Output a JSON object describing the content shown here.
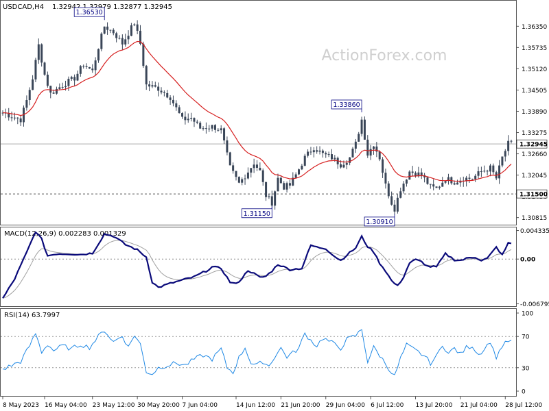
{
  "header": {
    "symbol": "USDCAD,H4",
    "ohlc": "1.32942 1.32979 1.32877 1.32945"
  },
  "watermark": "ActionForex.com",
  "colors": {
    "candle": "#3a4658",
    "ma": "#d62020",
    "macd_line": "#0a0a7a",
    "macd_signal": "#a0a0a0",
    "rsi": "#1e88e5",
    "frame": "#555555",
    "guide_line": "#7a7a7a"
  },
  "chart_data": [
    {
      "type": "line",
      "panel": "price",
      "title": "",
      "ylim": [
        1.3065,
        1.3705
      ],
      "y_ticks": [
        1.3635,
        1.35735,
        1.3512,
        1.34505,
        1.3389,
        1.33275,
        1.3266,
        1.32045,
        1.3143,
        1.30815
      ],
      "y_tick_labels": [
        "1.36350",
        "1.35735",
        "1.35120",
        "1.34505",
        "1.33890",
        "1.33275",
        "1.32660",
        "1.32045",
        "1.31430",
        "1.30815"
      ],
      "x_ticks": [
        0,
        14,
        30,
        45,
        60,
        78,
        93,
        108,
        123,
        138,
        153,
        168
      ],
      "x_tick_labels": [
        "8 May 2023",
        "16 May 04:00",
        "23 May 12:00",
        "30 May 20:00",
        "7 Jun 04:00",
        "14 Jun 12:00",
        "21 Jun 20:00",
        "29 Jun 04:00",
        "6 Jul 12:00",
        "13 Jul 20:00",
        "21 Jul 04:00",
        "28 Jul 12:00"
      ],
      "xlim": [
        0,
        170
      ],
      "close_anchors": [
        [
          0,
          1.3385
        ],
        [
          3,
          1.3375
        ],
        [
          6,
          1.3365
        ],
        [
          8,
          1.342
        ],
        [
          10,
          1.3485
        ],
        [
          12,
          1.358
        ],
        [
          14,
          1.3495
        ],
        [
          16,
          1.344
        ],
        [
          20,
          1.3465
        ],
        [
          24,
          1.3485
        ],
        [
          27,
          1.3525
        ],
        [
          30,
          1.3505
        ],
        [
          32,
          1.3575
        ],
        [
          34,
          1.3635
        ],
        [
          37,
          1.3618
        ],
        [
          40,
          1.3585
        ],
        [
          42,
          1.3615
        ],
        [
          44,
          1.3645
        ],
        [
          46,
          1.3585
        ],
        [
          48,
          1.3465
        ],
        [
          52,
          1.3455
        ],
        [
          56,
          1.343
        ],
        [
          60,
          1.3365
        ],
        [
          63,
          1.337
        ],
        [
          66,
          1.334
        ],
        [
          70,
          1.3345
        ],
        [
          73,
          1.3335
        ],
        [
          76,
          1.3225
        ],
        [
          79,
          1.318
        ],
        [
          82,
          1.3215
        ],
        [
          84,
          1.324
        ],
        [
          86,
          1.3215
        ],
        [
          88,
          1.3145
        ],
        [
          90,
          1.3125
        ],
        [
          92,
          1.3195
        ],
        [
          94,
          1.317
        ],
        [
          96,
          1.3175
        ],
        [
          98,
          1.3205
        ],
        [
          101,
          1.3255
        ],
        [
          104,
          1.3285
        ],
        [
          107,
          1.3265
        ],
        [
          110,
          1.3255
        ],
        [
          113,
          1.3235
        ],
        [
          116,
          1.3255
        ],
        [
          118,
          1.3295
        ],
        [
          120,
          1.3365
        ],
        [
          122,
          1.3265
        ],
        [
          124,
          1.3295
        ],
        [
          126,
          1.3255
        ],
        [
          128,
          1.3175
        ],
        [
          130,
          1.3125
        ],
        [
          131,
          1.3108
        ],
        [
          133,
          1.3165
        ],
        [
          136,
          1.3215
        ],
        [
          140,
          1.3205
        ],
        [
          143,
          1.317
        ],
        [
          145,
          1.3165
        ],
        [
          148,
          1.3195
        ],
        [
          151,
          1.3185
        ],
        [
          154,
          1.3195
        ],
        [
          157,
          1.3195
        ],
        [
          160,
          1.3215
        ],
        [
          163,
          1.3225
        ],
        [
          165,
          1.3195
        ],
        [
          167,
          1.3255
        ],
        [
          169,
          1.3295
        ]
      ],
      "series": [
        {
          "name": "",
          "style": "candles",
          "values": "derived from close_anchors"
        },
        {
          "name": "",
          "style": "moving-average",
          "values": "smoothed closes"
        }
      ],
      "annotations": [
        {
          "text": "1.36530",
          "x": 34,
          "y": 1.3653
        },
        {
          "text": "1.33860",
          "x": 120,
          "y": 1.3386
        },
        {
          "text": "1.31150",
          "x": 90,
          "y": 1.3115
        },
        {
          "text": "1.30910",
          "x": 131,
          "y": 1.3091
        }
      ],
      "price_line": {
        "value": 1.32945,
        "label": "1.32945"
      },
      "level_line": {
        "value": 1.315,
        "label": "1.31500",
        "style": "dashed"
      }
    },
    {
      "type": "line",
      "panel": "macd",
      "title": "MACD(12,26,9) 0.002283 0.001329",
      "ylim": [
        -0.00705,
        0.0046
      ],
      "y_ticks": [
        0.004335,
        0.0,
        -0.006795
      ],
      "y_tick_labels": [
        "0.004335",
        "0.00",
        "-0.006795"
      ],
      "macd_anchors": [
        [
          0,
          -0.006
        ],
        [
          4,
          -0.003
        ],
        [
          8,
          0.001
        ],
        [
          11,
          0.0042
        ],
        [
          13,
          0.003
        ],
        [
          15,
          0.0005
        ],
        [
          18,
          0.0008
        ],
        [
          22,
          0.0008
        ],
        [
          26,
          0.0007
        ],
        [
          30,
          0.0009
        ],
        [
          34,
          0.0038
        ],
        [
          37,
          0.0035
        ],
        [
          41,
          0.0022
        ],
        [
          45,
          0.0014
        ],
        [
          48,
          0.0003
        ],
        [
          50,
          -0.0035
        ],
        [
          52,
          -0.0043
        ],
        [
          56,
          -0.0037
        ],
        [
          60,
          -0.0032
        ],
        [
          64,
          -0.0027
        ],
        [
          68,
          -0.0018
        ],
        [
          70,
          -0.0012
        ],
        [
          73,
          -0.0014
        ],
        [
          76,
          -0.0035
        ],
        [
          78,
          -0.0038
        ],
        [
          80,
          -0.0029
        ],
        [
          82,
          -0.0017
        ],
        [
          84,
          -0.0022
        ],
        [
          86,
          -0.0028
        ],
        [
          88,
          -0.0026
        ],
        [
          90,
          -0.0018
        ],
        [
          92,
          -0.0008
        ],
        [
          94,
          -0.0012
        ],
        [
          96,
          -0.0016
        ],
        [
          100,
          -0.0014
        ],
        [
          103,
          0.0021
        ],
        [
          105,
          0.0018
        ],
        [
          108,
          0.0016
        ],
        [
          111,
          0.0004
        ],
        [
          113,
          -0.0002
        ],
        [
          115,
          0.0006
        ],
        [
          118,
          0.0017
        ],
        [
          120,
          0.0034
        ],
        [
          122,
          0.0019
        ],
        [
          124,
          0.0011
        ],
        [
          126,
          -0.0006
        ],
        [
          128,
          -0.0018
        ],
        [
          130,
          -0.0033
        ],
        [
          132,
          -0.0041
        ],
        [
          134,
          -0.0027
        ],
        [
          136,
          -0.0006
        ],
        [
          138,
          -0.0001
        ],
        [
          140,
          -0.0004
        ],
        [
          142,
          -0.0011
        ],
        [
          145,
          -0.0012
        ],
        [
          148,
          0.0008
        ],
        [
          151,
          -0.0001
        ],
        [
          153,
          -0.0002
        ],
        [
          156,
          0.0002
        ],
        [
          158,
          0.0003
        ],
        [
          160,
          -0.0002
        ],
        [
          162,
          0.0001
        ],
        [
          165,
          0.0018
        ],
        [
          167,
          0.0006
        ],
        [
          169,
          0.0024
        ]
      ],
      "series": [
        {
          "name": "",
          "style": "macd",
          "values": "from macd_anchors"
        },
        {
          "name": "",
          "style": "signal",
          "values": "smoothed macd"
        }
      ]
    },
    {
      "type": "line",
      "panel": "rsi",
      "title": "RSI(14) 63.7997",
      "ylim": [
        0,
        100
      ],
      "y_ticks": [
        100,
        70,
        30,
        0
      ],
      "y_tick_labels": [
        "100",
        "70",
        "30",
        "0"
      ],
      "levels": [
        70,
        30
      ],
      "rsi_anchors": [
        [
          0,
          28
        ],
        [
          3,
          33
        ],
        [
          6,
          38
        ],
        [
          9,
          58
        ],
        [
          11,
          74
        ],
        [
          13,
          50
        ],
        [
          15,
          60
        ],
        [
          17,
          52
        ],
        [
          20,
          58
        ],
        [
          23,
          54
        ],
        [
          26,
          60
        ],
        [
          29,
          56
        ],
        [
          32,
          70
        ],
        [
          34,
          78
        ],
        [
          37,
          63
        ],
        [
          40,
          71
        ],
        [
          42,
          56
        ],
        [
          44,
          72
        ],
        [
          46,
          60
        ],
        [
          48,
          25
        ],
        [
          50,
          22
        ],
        [
          52,
          30
        ],
        [
          55,
          33
        ],
        [
          58,
          36
        ],
        [
          61,
          33
        ],
        [
          64,
          41
        ],
        [
          67,
          46
        ],
        [
          70,
          41
        ],
        [
          73,
          54
        ],
        [
          75,
          30
        ],
        [
          77,
          24
        ],
        [
          79,
          43
        ],
        [
          81,
          56
        ],
        [
          83,
          36
        ],
        [
          85,
          33
        ],
        [
          87,
          38
        ],
        [
          89,
          32
        ],
        [
          91,
          45
        ],
        [
          93,
          55
        ],
        [
          95,
          44
        ],
        [
          97,
          49
        ],
        [
          99,
          55
        ],
        [
          101,
          74
        ],
        [
          103,
          65
        ],
        [
          105,
          58
        ],
        [
          107,
          68
        ],
        [
          110,
          62
        ],
        [
          113,
          55
        ],
        [
          115,
          66
        ],
        [
          118,
          71
        ],
        [
          120,
          79
        ],
        [
          122,
          38
        ],
        [
          124,
          56
        ],
        [
          126,
          46
        ],
        [
          128,
          35
        ],
        [
          130,
          24
        ],
        [
          131,
          19
        ],
        [
          133,
          42
        ],
        [
          135,
          59
        ],
        [
          138,
          52
        ],
        [
          141,
          45
        ],
        [
          143,
          36
        ],
        [
          145,
          44
        ],
        [
          147,
          60
        ],
        [
          149,
          48
        ],
        [
          151,
          55
        ],
        [
          153,
          47
        ],
        [
          155,
          56
        ],
        [
          157,
          58
        ],
        [
          159,
          47
        ],
        [
          161,
          54
        ],
        [
          163,
          64
        ],
        [
          164,
          52
        ],
        [
          165,
          44
        ],
        [
          167,
          58
        ],
        [
          169,
          64
        ]
      ],
      "series": [
        {
          "name": "",
          "style": "rsi",
          "values": "from rsi_anchors"
        }
      ]
    }
  ]
}
